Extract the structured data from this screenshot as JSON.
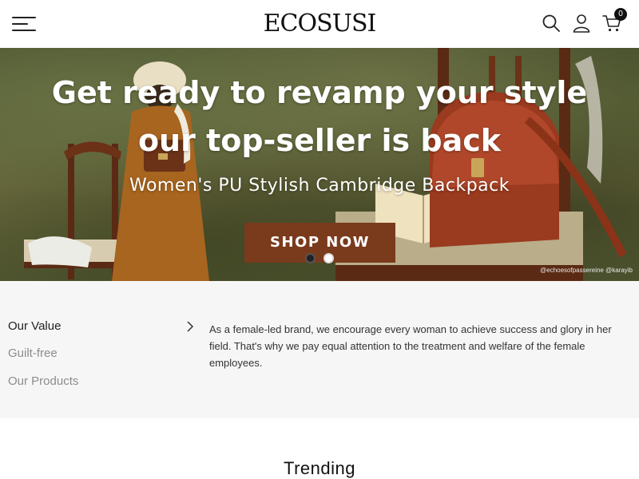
{
  "header": {
    "logo": "ECOSUSI",
    "cart_count": "0"
  },
  "hero": {
    "title_line1": "Get ready to revamp your style",
    "title_line2": "our top-seller is back",
    "subtitle": "Women's PU Stylish Cambridge Backpack",
    "cta_label": "SHOP NOW",
    "photo_credit": "@echoesofpassereine @karayib",
    "slides_total": 2,
    "slide_active": 1
  },
  "values": {
    "items": [
      {
        "label": "Our Value",
        "active": true
      },
      {
        "label": "Guilt-free",
        "active": false
      },
      {
        "label": "Our Products",
        "active": false
      }
    ],
    "description": "As a female-led brand, we encourage every woman to achieve success and glory in her field. That's why we pay equal attention to the treatment and welfare of the female employees."
  },
  "trending": {
    "heading": "Trending"
  },
  "icons": {
    "menu": "hamburger-icon",
    "search": "search-icon",
    "account": "user-icon",
    "cart": "cart-icon",
    "chevron": "chevron-right-icon"
  },
  "colors": {
    "cta": "#7a3a1c",
    "values_bg": "#f6f6f6",
    "muted_text": "#8c8c8c"
  }
}
